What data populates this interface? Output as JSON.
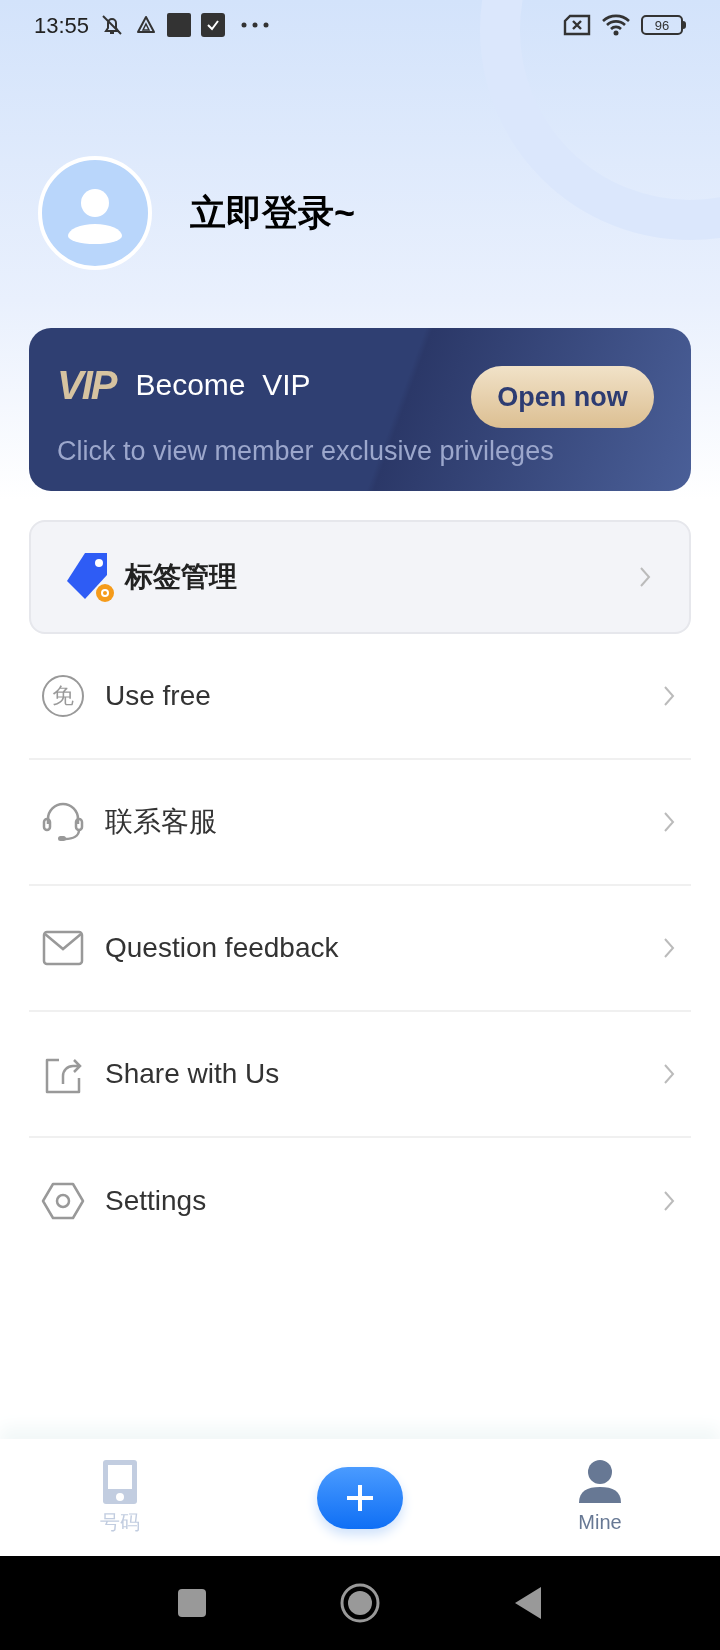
{
  "status_bar": {
    "time": "13:55",
    "battery": "96"
  },
  "profile": {
    "title": "立即登录~"
  },
  "vip_card": {
    "logo": "VIP",
    "title": "Become  VIP",
    "subtitle": "Click to view member exclusive privileges",
    "button": "Open now"
  },
  "tag_card": {
    "label": "标签管理"
  },
  "menu": [
    {
      "kind": "free",
      "icon_text": "免",
      "label": "Use free"
    },
    {
      "kind": "headset",
      "label": "联系客服"
    },
    {
      "kind": "mail",
      "label": "Question feedback"
    },
    {
      "kind": "share",
      "label": "Share with Us"
    },
    {
      "kind": "settings",
      "label": "Settings"
    }
  ],
  "tab_bar": {
    "tabs": [
      {
        "kind": "phone",
        "label": "号码",
        "selected": false
      },
      {
        "kind": "add"
      },
      {
        "kind": "person",
        "label": "Mine",
        "selected": true
      }
    ]
  }
}
